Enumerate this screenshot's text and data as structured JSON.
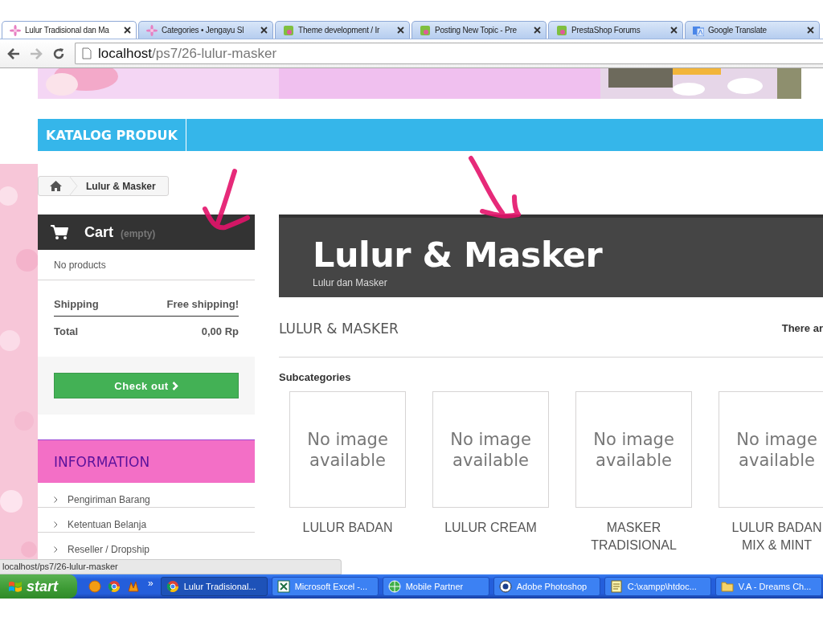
{
  "browser": {
    "tabs": [
      {
        "title": "Lulur Tradisional dan Ma",
        "kind": "flower",
        "selected": true
      },
      {
        "title": "Categories • Jengayu Sl",
        "kind": "flower",
        "selected": false
      },
      {
        "title": "Theme development / Ir",
        "kind": "shop",
        "selected": false
      },
      {
        "title": "Posting New Topic - Pre",
        "kind": "shop",
        "selected": false
      },
      {
        "title": "PrestaShop Forums",
        "kind": "shop",
        "selected": false
      },
      {
        "title": "Google Translate",
        "kind": "translate",
        "selected": false
      }
    ],
    "address": {
      "host": "localhost",
      "path": "/ps7/26-lulur-masker"
    }
  },
  "page": {
    "nav": [
      {
        "label": "KATALOG PRODUK"
      }
    ],
    "breadcrumb": [
      "Lulur & Masker"
    ],
    "cart": {
      "title": "Cart",
      "status": "(empty)",
      "empty_text": "No products",
      "rows": [
        {
          "label": "Shipping",
          "value": "Free shipping!"
        },
        {
          "label": "Total",
          "value": "0,00 Rp"
        }
      ],
      "checkout": "Check out"
    },
    "information": {
      "title": "INFORMATION",
      "items": [
        "Pengiriman Barang",
        "Ketentuan Belanja",
        "Reseller / Dropship"
      ]
    },
    "category": {
      "title": "Lulur & Masker",
      "description": "Lulur dan Masker",
      "heading": "LULUR & MASKER",
      "count_text": "There ar",
      "subcategories_label": "Subcategories",
      "subcategories": [
        {
          "name": "LULUR BADAN",
          "image_text": "No image available"
        },
        {
          "name": "LULUR CREAM",
          "image_text": "No image available"
        },
        {
          "name": "MASKER TRADISIONAL",
          "image_text": "No image available"
        },
        {
          "name": "LULUR BADAN MIX & MINT",
          "image_text": "No image available"
        }
      ]
    }
  },
  "status_url": "localhost/ps7/26-lulur-masker",
  "taskbar": {
    "start": "start",
    "overflow": "»",
    "tasks": [
      {
        "label": "Lulur Tradisional...",
        "kind": "browser",
        "selected": true
      },
      {
        "label": "Microsoft Excel -...",
        "kind": "sheet",
        "selected": false
      },
      {
        "label": "Mobile Partner",
        "kind": "globe",
        "selected": false
      },
      {
        "label": "Adobe Photoshop",
        "kind": "eye",
        "selected": false
      },
      {
        "label": "C:\\xampp\\htdoc...",
        "kind": "note",
        "selected": false
      },
      {
        "label": "V.A - Dreams Ch...",
        "kind": "folder",
        "selected": false
      }
    ]
  }
}
